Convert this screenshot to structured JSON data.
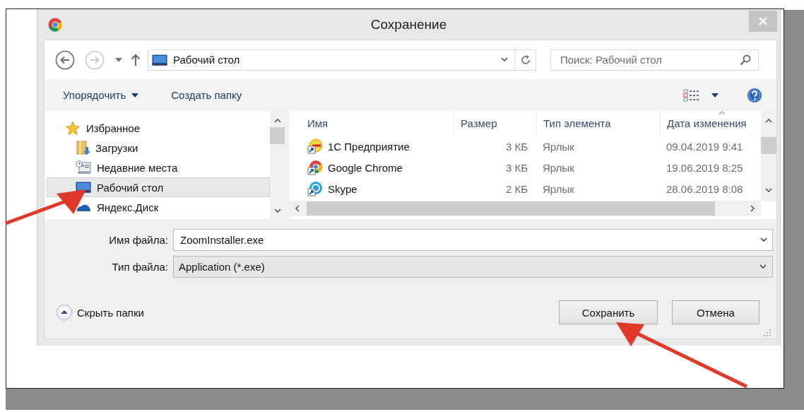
{
  "window": {
    "title": "Сохранение"
  },
  "nav_buttons": [
    {
      "kind": "back",
      "disabled": false
    },
    {
      "kind": "forward",
      "disabled": true
    }
  ],
  "address_bar": {
    "path": "Рабочий стол"
  },
  "search": {
    "placeholder": "Поиск: Рабочий стол"
  },
  "toolbar": [
    {
      "label": "Упорядочить",
      "kind": "menu"
    },
    {
      "label": "Создать папку",
      "kind": "button"
    }
  ],
  "nav_tree": [
    {
      "label": "Избранное",
      "selected": false,
      "children": [
        {
          "label": "Загрузки",
          "selected": false
        },
        {
          "label": "Недавние места",
          "selected": false
        },
        {
          "label": "Рабочий стол",
          "selected": true
        },
        {
          "label": "Яндекс.Диск",
          "selected": false
        }
      ]
    }
  ],
  "file_list": {
    "columns": [
      {
        "label": "Имя",
        "sorted": false
      },
      {
        "label": "Размер",
        "sorted": false
      },
      {
        "label": "Тип элемента",
        "sorted": false
      },
      {
        "label": "Дата изменения",
        "sorted": true
      }
    ],
    "rows": [
      {
        "name": "1С Предприятие",
        "size": "3 КБ",
        "type": "Ярлык",
        "modified": "09.04.2019 9:41"
      },
      {
        "name": "Google Chrome",
        "size": "3 КБ",
        "type": "Ярлык",
        "modified": "19.06.2019 8:25"
      },
      {
        "name": "Skype",
        "size": "2 КБ",
        "type": "Ярлык",
        "modified": "28.06.2019 8:08"
      }
    ]
  },
  "file_name": {
    "label": "Имя файла:",
    "value": "ZoomInstaller.exe"
  },
  "file_type": {
    "label": "Тип файла:",
    "value": "Application (*.exe)"
  },
  "hide_folders": {
    "label": "Скрыть папки"
  },
  "buttons": [
    "Сохранить",
    "Отмена"
  ]
}
